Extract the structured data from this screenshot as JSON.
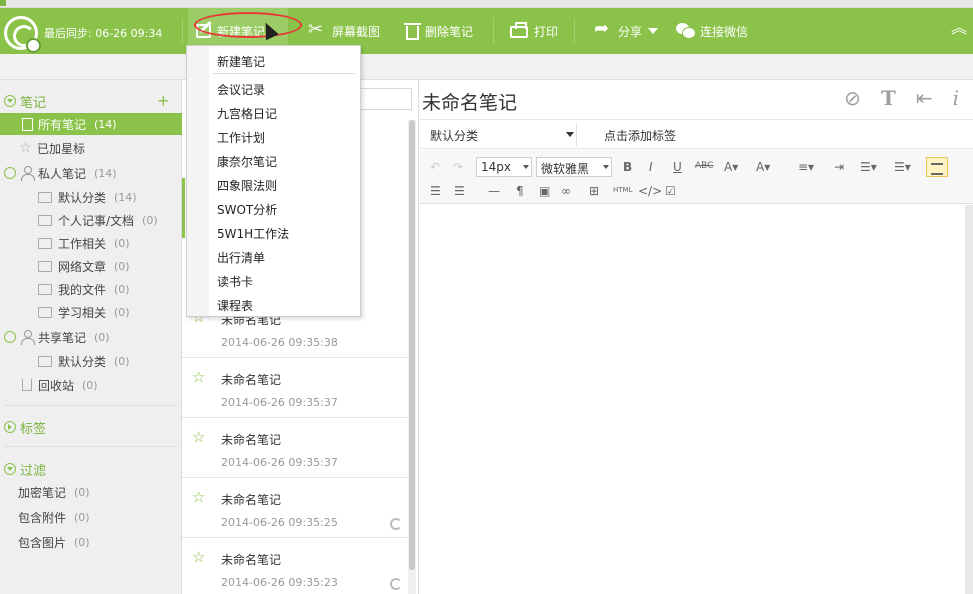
{
  "toolbar": {
    "sync_label": "最后同步: 06-26 09:34",
    "new_note": "新建笔记",
    "screenshot": "屏幕截图",
    "delete_note": "删除笔记",
    "print": "打印",
    "share": "分享",
    "wechat": "连接微信",
    "accent_color": "#8bc34a"
  },
  "new_note_menu": {
    "items": [
      "新建笔记",
      "会议记录",
      "九宫格日记",
      "工作计划",
      "康奈尔笔记",
      "四象限法则",
      "SWOT分析",
      "5W1H工作法",
      "出行清单",
      "读书卡",
      "课程表"
    ]
  },
  "sidebar": {
    "notes_section": "笔记",
    "all_notes": {
      "label": "所有笔记",
      "count": "(14)"
    },
    "starred": {
      "label": "已加星标",
      "count": ""
    },
    "personal": {
      "label": "私人笔记",
      "count": "(14)"
    },
    "personal_folders": [
      {
        "label": "默认分类",
        "count": "(14)"
      },
      {
        "label": "个人记事/文档",
        "count": "(0)"
      },
      {
        "label": "工作相关",
        "count": "(0)"
      },
      {
        "label": "网络文章",
        "count": "(0)"
      },
      {
        "label": "我的文件",
        "count": "(0)"
      },
      {
        "label": "学习相关",
        "count": "(0)"
      }
    ],
    "shared": {
      "label": "共享笔记",
      "count": "(0)"
    },
    "shared_folders": [
      {
        "label": "默认分类",
        "count": "(0)"
      }
    ],
    "recycle": {
      "label": "回收站",
      "count": "(0)"
    },
    "tags_section": "标签",
    "filter_section": "过滤",
    "filters": [
      {
        "label": "加密笔记",
        "count": "(0)"
      },
      {
        "label": "包含附件",
        "count": "(0)"
      },
      {
        "label": "包含图片",
        "count": "(0)"
      }
    ]
  },
  "note_list": {
    "notes": [
      {
        "title": "未命名笔记",
        "date": "2014-06-26 09:35:38"
      },
      {
        "title": "未命名笔记",
        "date": "2014-06-26 09:35:37"
      },
      {
        "title": "未命名笔记",
        "date": "2014-06-26 09:35:37"
      },
      {
        "title": "未命名笔记",
        "date": "2014-06-26 09:35:25"
      },
      {
        "title": "未命名笔记",
        "date": "2014-06-26 09:35:23"
      }
    ]
  },
  "editor": {
    "title": "未命名笔记",
    "category": "默认分类",
    "add_tag": "点击添加标签",
    "font_size": "14px",
    "font_family": "微软雅黑",
    "html_label": "HTML"
  }
}
